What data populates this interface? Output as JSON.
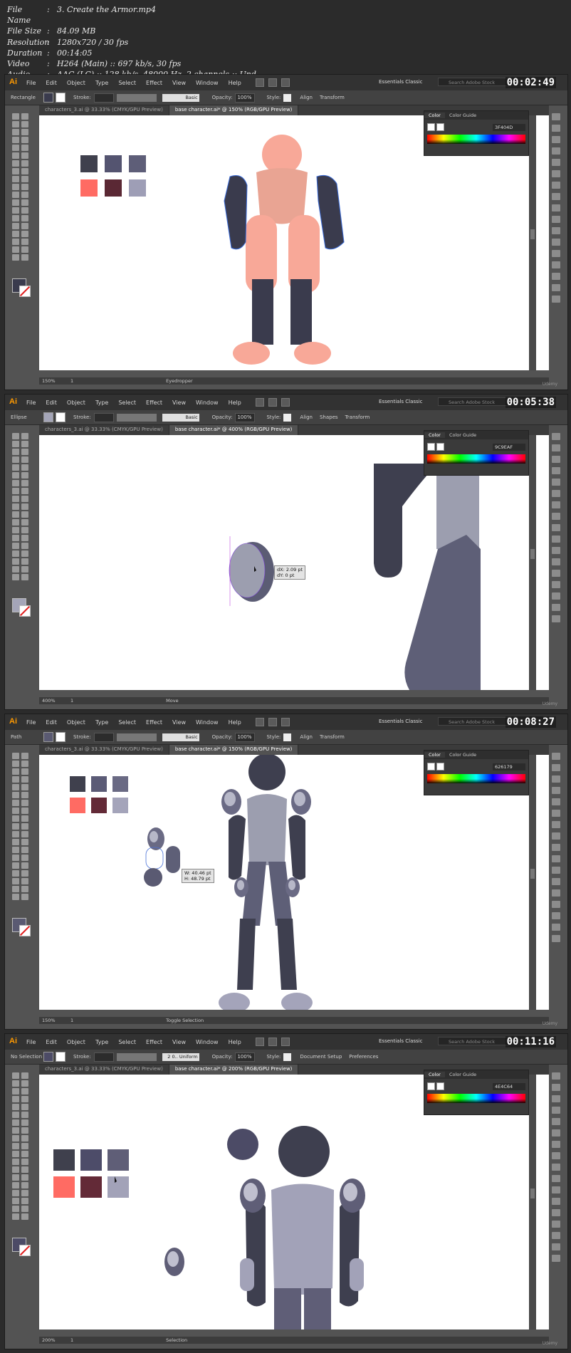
{
  "file_info": [
    {
      "key": "File Name",
      "value": "3. Create the Armor.mp4"
    },
    {
      "key": "File Size",
      "value": "84.09 MB"
    },
    {
      "key": "Resolution",
      "value": "1280x720 / 30 fps"
    },
    {
      "key": "Duration",
      "value": "00:14:05"
    },
    {
      "key": "Video",
      "value": "H264 (Main) :: 697 kb/s, 30 fps"
    },
    {
      "key": "Audio",
      "value": "AAC (LC) :: 128 kb/s, 48000 Hz, 2 channels :: Und"
    }
  ],
  "app": {
    "logo": "Ai",
    "menu": [
      "File",
      "Edit",
      "Object",
      "Type",
      "Select",
      "Effect",
      "View",
      "Window",
      "Help"
    ],
    "workspace": "Essentials Classic",
    "stock_placeholder": "Search Adobe Stock",
    "stroke_label": "Stroke:",
    "opacity_label": "Opacity:",
    "opacity_value": "100%",
    "style_label": "Style:",
    "stroke_profile": "Basic",
    "color_tab": "Color",
    "guide_tab": "Color Guide",
    "watermark": "Udemy"
  },
  "frames": [
    {
      "timer": "00:02:49",
      "tool": "Rectangle",
      "tab1": "characters_3.ai @ 33.33% (CMYK/GPU Preview)",
      "tab2": "base character.ai* @ 150% (RGB/GPU Preview)",
      "zoom": "150%",
      "page": "1",
      "status": "Eyedropper",
      "hex": "3F404D",
      "fill": "#3a3b4d",
      "buttons": [
        "Align",
        "Transform"
      ],
      "swatches": [
        "#3f404d",
        "#545470",
        "#5e5e78",
        "#ff6b63",
        "#5a2834",
        "#9e9eb6"
      ]
    },
    {
      "timer": "00:05:38",
      "tool": "Ellipse",
      "tab1": "characters_3.ai @ 33.33% (CMYK/GPU Preview)",
      "tab2": "base character.ai* @ 400% (RGB/GPU Preview)",
      "zoom": "400%",
      "page": "1",
      "status": "Move",
      "hex": "9C9EAF",
      "fill": "#a4a5b8",
      "buttons": [
        "Align",
        "Shapes",
        "Transform"
      ],
      "tooltip": [
        "dX: 2.09 pt",
        "dY: 0 pt"
      ]
    },
    {
      "timer": "00:08:27",
      "tool": "Path",
      "tab1": "characters_3.ai @ 33.33% (CMYK/GPU Preview)",
      "tab2": "base character.ai* @ 150% (RGB/GPU Preview)",
      "zoom": "150%",
      "page": "1",
      "status": "Toggle Selection",
      "hex": "626179",
      "fill": "#5a5a72",
      "buttons": [
        "Align",
        "Transform"
      ],
      "tooltip": [
        "W: 40.46 pt",
        "H: 48.79 pt"
      ],
      "swatches": [
        "#3f404d",
        "#5b5b76",
        "#6a6a84",
        "#ff6b63",
        "#632a37",
        "#a4a4ba"
      ]
    },
    {
      "timer": "00:11:16",
      "tool": "No Selection",
      "tab1": "characters_3.ai @ 33.33% (CMYK/GPU Preview)",
      "tab2": "base character.ai* @ 200% (RGB/GPU Preview)",
      "zoom": "200%",
      "page": "1",
      "status": "Selection",
      "hex": "4E4C64",
      "fill": "#4c4b66",
      "buttons": [
        "Document Setup",
        "Preferences"
      ],
      "stroke_value": "2 0.. Uniform",
      "swatches": [
        "#3f404d",
        "#4d4c69",
        "#5f5e77",
        "#ff6b63",
        "#632a37",
        "#a2a2b8"
      ]
    }
  ]
}
